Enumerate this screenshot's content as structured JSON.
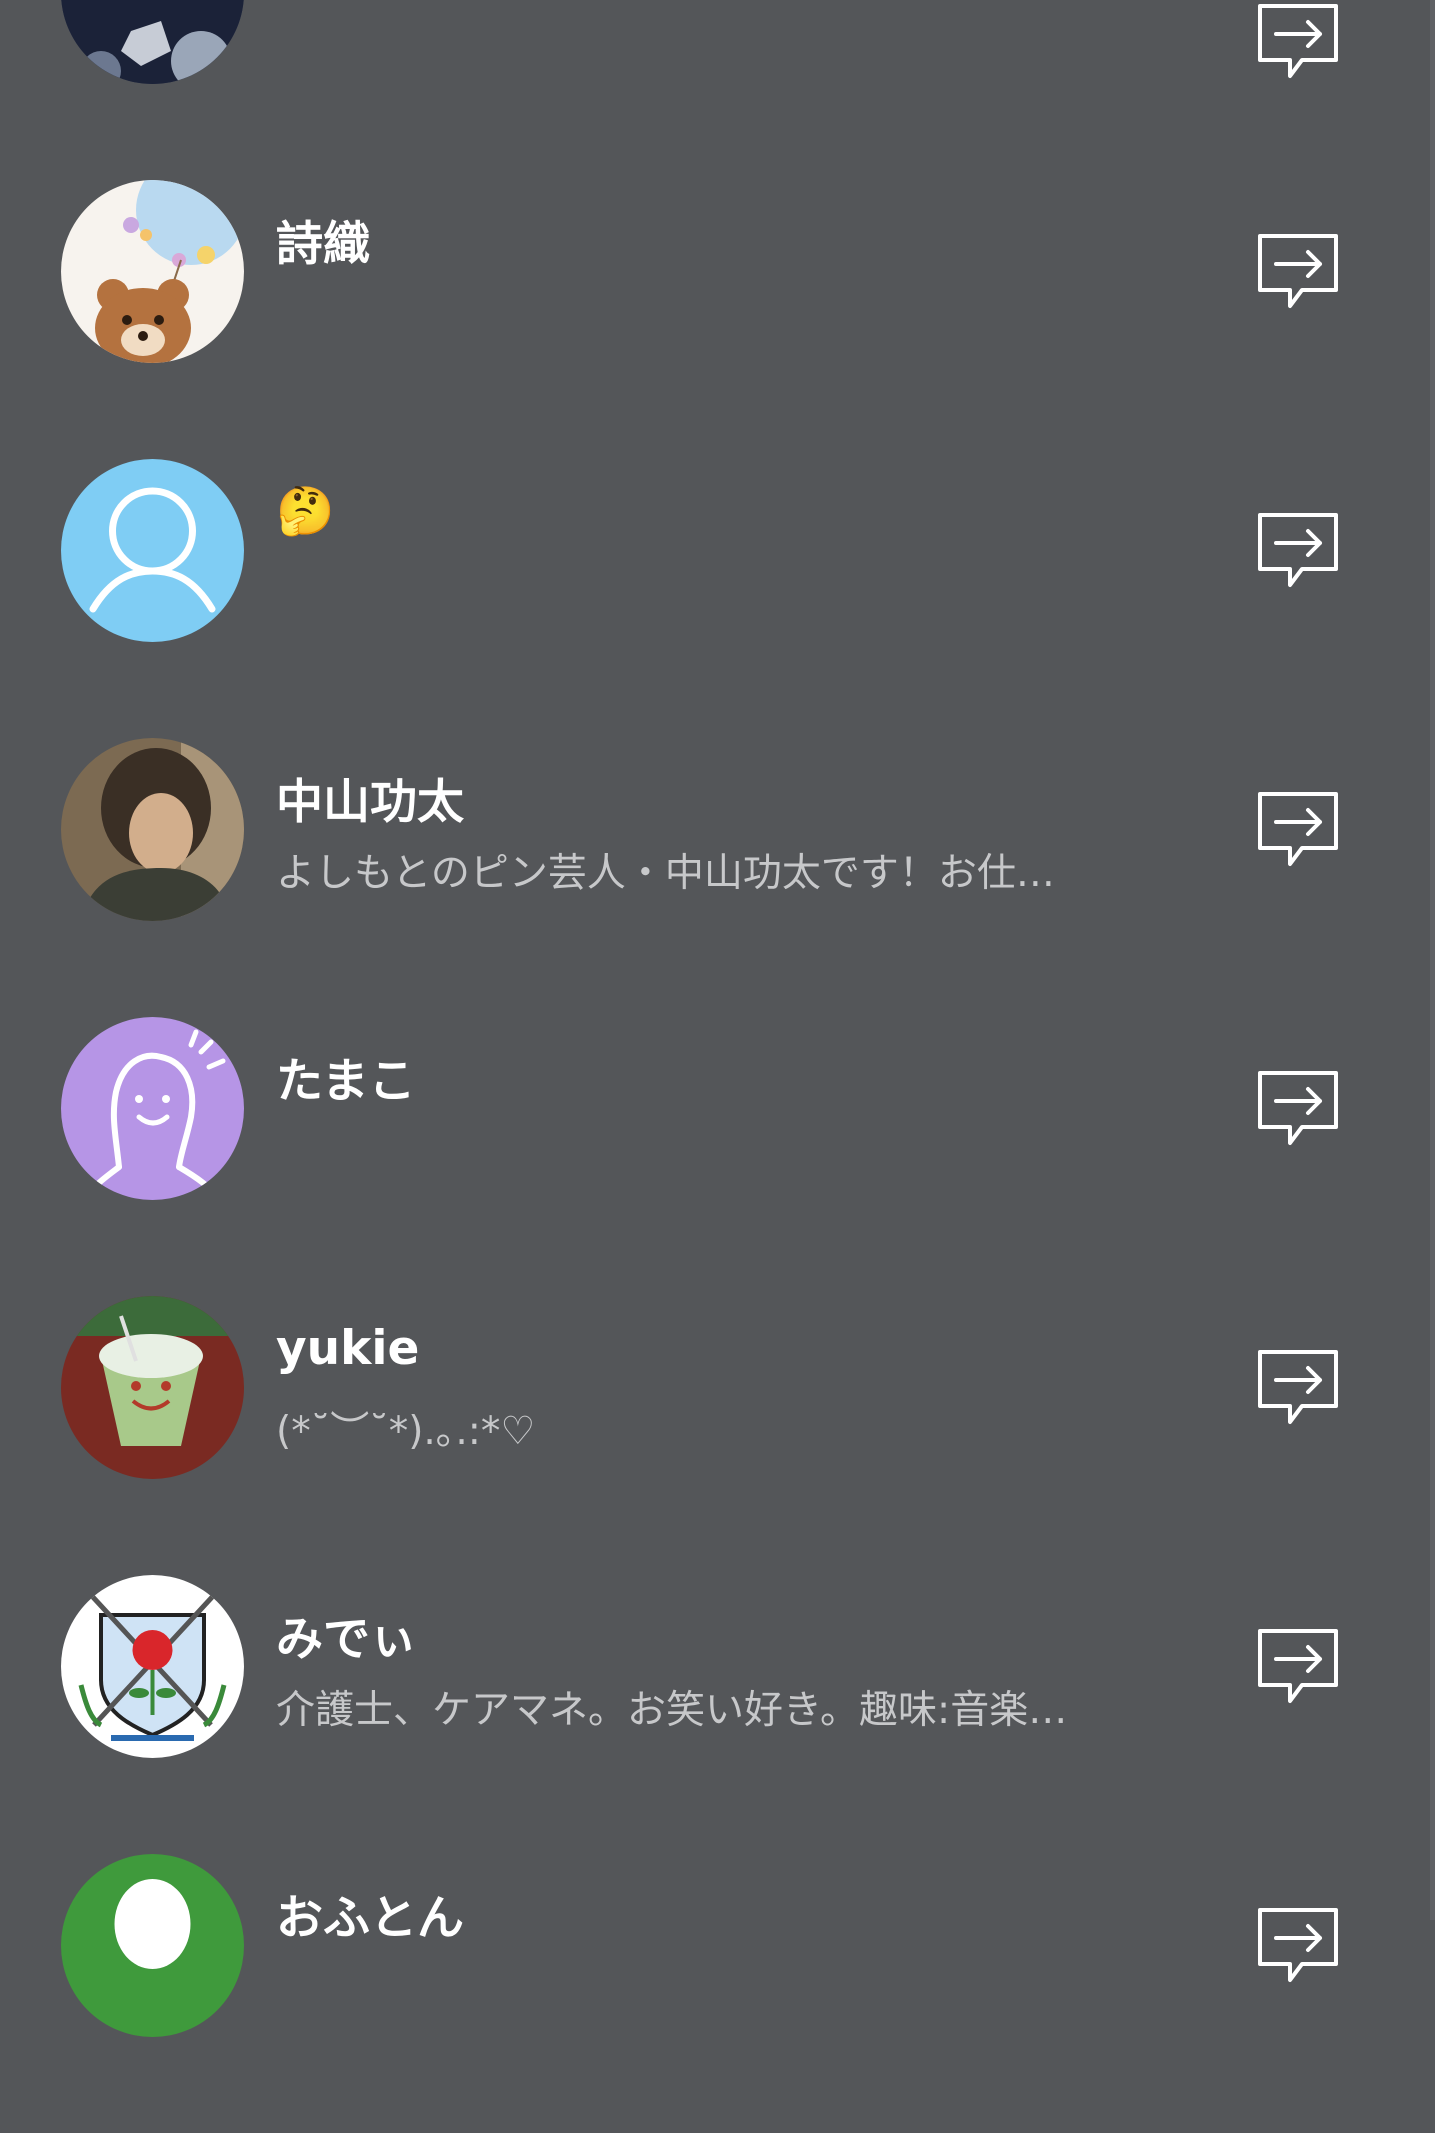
{
  "icons": {
    "share": "share-arrow-icon"
  },
  "colors": {
    "background": "#545659",
    "name_text": "#ffffff",
    "status_text": "#c7c8ca",
    "default_avatar_blue": "#7fcdf4",
    "default_avatar_purple": "#b695e6"
  },
  "friends": [
    {
      "name": "",
      "status": ""
    },
    {
      "name": "詩織",
      "status": ""
    },
    {
      "name": "🤔",
      "status": ""
    },
    {
      "name": "中山功太",
      "status": "よしもとのピン芸人・中山功太です！お仕…"
    },
    {
      "name": "たまこ",
      "status": ""
    },
    {
      "name": "yukie",
      "status": "(*˘︶˘*).｡.:*♡"
    },
    {
      "name": "みでぃ",
      "status": "介護士、ケアマネ。お笑い好き。趣味:音楽…"
    },
    {
      "name": "おふとん",
      "status": ""
    }
  ]
}
